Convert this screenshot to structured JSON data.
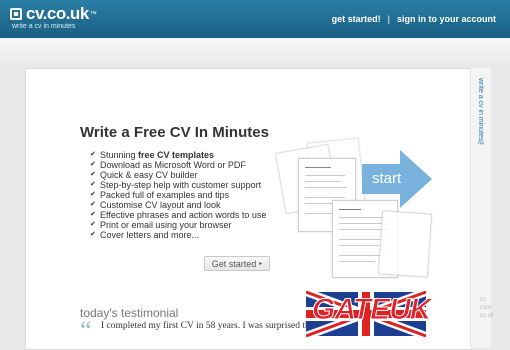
{
  "header": {
    "logo_text": "cv.co.uk",
    "logo_tm": "™",
    "tagline": "write a cv in minutes",
    "nav": {
      "get_started": "get started!",
      "separator": "|",
      "sign_in": "sign in to your account"
    }
  },
  "side_tab": {
    "label": "write a cv in minutes™"
  },
  "main": {
    "headline": "Write a Free CV In Minutes",
    "features": [
      {
        "prefix": "Stunning ",
        "bold": "free CV templates"
      },
      {
        "prefix": "Download as Microsoft Word or PDF",
        "bold": ""
      },
      {
        "prefix": "Quick & easy CV builder",
        "bold": ""
      },
      {
        "prefix": "Step-by-step help with customer support",
        "bold": ""
      },
      {
        "prefix": "Packed full of examples and tips",
        "bold": ""
      },
      {
        "prefix": "Customise CV layout and look",
        "bold": ""
      },
      {
        "prefix": "Effective phrases and action words to use",
        "bold": ""
      },
      {
        "prefix": "Print or email using your browser",
        "bold": ""
      },
      {
        "prefix": "Cover letters and more...",
        "bold": ""
      }
    ],
    "start_label": "start",
    "get_started_button": "Get started",
    "get_started_caret": "▸"
  },
  "testimonial": {
    "title": "today's testimonial",
    "quote_mark": "“",
    "text": "I completed my first CV in 58 years. I was surprised th... was almost painless."
  },
  "watermark": {
    "text": "GATEUK",
    "side": ".co\n.com\n.co.uk"
  },
  "colors": {
    "header_blue": "#1a5f82",
    "link_blue": "#1f7aa8",
    "arrow_blue": "#6aaad8",
    "watermark_red": "#e0212b"
  }
}
